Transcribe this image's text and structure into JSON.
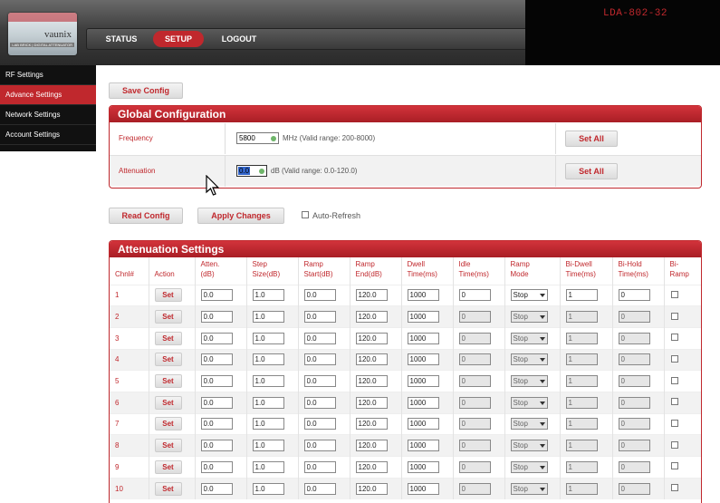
{
  "device": {
    "name": "LDA-802-32"
  },
  "logo": {
    "text": "vaunix",
    "sub": "LAB BRICK | DIGITAL ATTENUATOR"
  },
  "nav": {
    "status": "STATUS",
    "setup": "SETUP",
    "logout": "LOGOUT"
  },
  "sidebar": {
    "items": [
      {
        "label": "RF Settings"
      },
      {
        "label": "Advance Settings"
      },
      {
        "label": "Network Settings"
      },
      {
        "label": "Account Settings"
      }
    ]
  },
  "buttons": {
    "save_config": "Save Config",
    "read_config": "Read Config",
    "apply_changes": "Apply Changes",
    "set_all": "Set All",
    "set": "Set"
  },
  "auto_refresh": {
    "label": "Auto-Refresh",
    "checked": false
  },
  "global": {
    "title": "Global Configuration",
    "frequency": {
      "label": "Frequency",
      "value": "5800",
      "hint": "MHz (Valid range: 200-8000)"
    },
    "attenuation": {
      "label": "Attenuation",
      "value": "0.0",
      "hint": "dB (Valid range: 0.0-120.0)"
    }
  },
  "att_settings": {
    "title": "Attenuation Settings",
    "headers": {
      "chnl": "Chnl#",
      "action": "Action",
      "atten_1": "Atten.",
      "atten_2": "(dB)",
      "step_1": "Step",
      "step_2": "Size(dB)",
      "rstart_1": "Ramp",
      "rstart_2": "Start(dB)",
      "rend_1": "Ramp",
      "rend_2": "End(dB)",
      "dwell_1": "Dwell",
      "dwell_2": "Time(ms)",
      "idle_1": "Idle",
      "idle_2": "Time(ms)",
      "rmode_1": "Ramp",
      "rmode_2": "Mode",
      "bidwell_1": "Bi-Dwell",
      "bidwell_2": "Time(ms)",
      "bihold_1": "Bi-Hold",
      "bihold_2": "Time(ms)",
      "biramp_1": "Bi-",
      "biramp_2": "Ramp"
    },
    "rows": [
      {
        "ch": "1",
        "atten": "0.0",
        "step": "1.0",
        "rstart": "0.0",
        "rend": "120.0",
        "dwell": "1000",
        "idle": "0",
        "mode": "Stop",
        "bidwell": "1",
        "bihold": "0"
      },
      {
        "ch": "2",
        "atten": "0.0",
        "step": "1.0",
        "rstart": "0.0",
        "rend": "120.0",
        "dwell": "1000",
        "idle": "0",
        "mode": "Stop",
        "bidwell": "1",
        "bihold": "0"
      },
      {
        "ch": "3",
        "atten": "0.0",
        "step": "1.0",
        "rstart": "0.0",
        "rend": "120.0",
        "dwell": "1000",
        "idle": "0",
        "mode": "Stop",
        "bidwell": "1",
        "bihold": "0"
      },
      {
        "ch": "4",
        "atten": "0.0",
        "step": "1.0",
        "rstart": "0.0",
        "rend": "120.0",
        "dwell": "1000",
        "idle": "0",
        "mode": "Stop",
        "bidwell": "1",
        "bihold": "0"
      },
      {
        "ch": "5",
        "atten": "0.0",
        "step": "1.0",
        "rstart": "0.0",
        "rend": "120.0",
        "dwell": "1000",
        "idle": "0",
        "mode": "Stop",
        "bidwell": "1",
        "bihold": "0"
      },
      {
        "ch": "6",
        "atten": "0.0",
        "step": "1.0",
        "rstart": "0.0",
        "rend": "120.0",
        "dwell": "1000",
        "idle": "0",
        "mode": "Stop",
        "bidwell": "1",
        "bihold": "0"
      },
      {
        "ch": "7",
        "atten": "0.0",
        "step": "1.0",
        "rstart": "0.0",
        "rend": "120.0",
        "dwell": "1000",
        "idle": "0",
        "mode": "Stop",
        "bidwell": "1",
        "bihold": "0"
      },
      {
        "ch": "8",
        "atten": "0.0",
        "step": "1.0",
        "rstart": "0.0",
        "rend": "120.0",
        "dwell": "1000",
        "idle": "0",
        "mode": "Stop",
        "bidwell": "1",
        "bihold": "0"
      },
      {
        "ch": "9",
        "atten": "0.0",
        "step": "1.0",
        "rstart": "0.0",
        "rend": "120.0",
        "dwell": "1000",
        "idle": "0",
        "mode": "Stop",
        "bidwell": "1",
        "bihold": "0"
      },
      {
        "ch": "10",
        "atten": "0.0",
        "step": "1.0",
        "rstart": "0.0",
        "rend": "120.0",
        "dwell": "1000",
        "idle": "0",
        "mode": "Stop",
        "bidwell": "1",
        "bihold": "0"
      }
    ]
  },
  "colors": {
    "accent": "#c0282d",
    "header": "#3e3e3e",
    "sidebar": "#111111"
  }
}
